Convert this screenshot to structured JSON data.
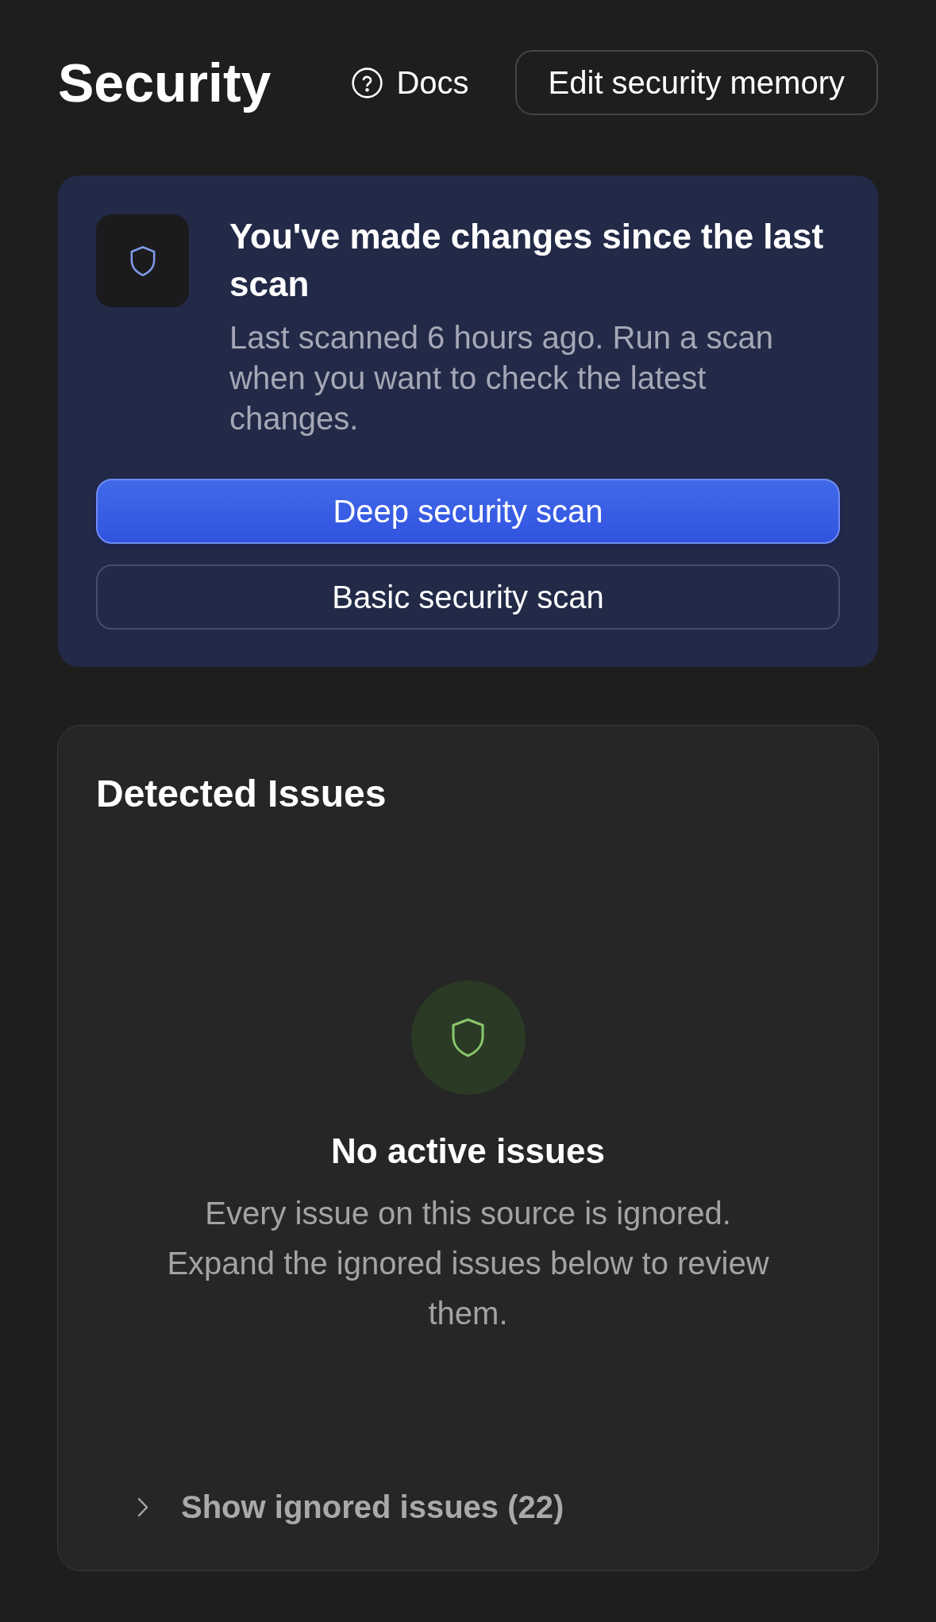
{
  "header": {
    "title": "Security",
    "docs_link": "Docs",
    "edit_button": "Edit security memory"
  },
  "scan_banner": {
    "title": "You've made changes since the last scan",
    "description": "Last scanned 6 hours ago. Run a scan when you want to check the latest changes.",
    "actions": [
      {
        "label": "Deep security scan",
        "kind": "primary"
      },
      {
        "label": "Basic security scan",
        "kind": "secondary"
      }
    ]
  },
  "detected_issues": {
    "title": "Detected Issues",
    "empty_state": {
      "title": "No active issues",
      "description": "Every issue on this source is ignored. Expand the ignored issues below to review them."
    },
    "ignored_toggle": {
      "label": "Show ignored issues (22)",
      "expanded": false
    }
  }
}
